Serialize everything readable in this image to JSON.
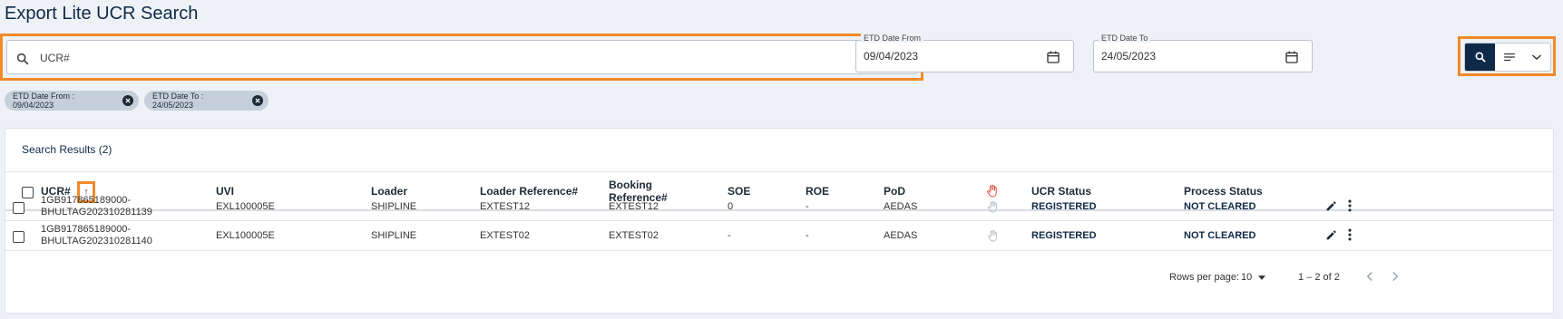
{
  "page": {
    "title": "Export Lite UCR Search"
  },
  "search": {
    "placeholder": "UCR#",
    "value": ""
  },
  "date_from": {
    "label": "ETD Date From",
    "value": "09/04/2023"
  },
  "date_to": {
    "label": "ETD Date To",
    "value": "24/05/2023"
  },
  "chips": [
    {
      "label": "ETD Date From : 09/04/2023"
    },
    {
      "label": "ETD Date To : 24/05/2023"
    }
  ],
  "results": {
    "title": "Search Results (2)",
    "columns": {
      "ucr": "UCR#",
      "uvi": "UVI",
      "loader": "Loader",
      "loader_ref": "Loader Reference#",
      "booking_ref_1": "Booking",
      "booking_ref_2": "Reference#",
      "soe": "SOE",
      "roe": "ROE",
      "pod": "PoD",
      "ucr_status": "UCR Status",
      "process_status": "Process Status"
    },
    "rows": [
      {
        "ucr_line1": "1GB917865189000-",
        "ucr_line2": "BHULTAG202310281139",
        "uvi": "EXL100005E",
        "loader": "SHIPLINE",
        "loader_ref": "EXTEST12",
        "booking_ref": "EXTEST12",
        "soe": "0",
        "roe": "-",
        "pod": "AEDAS",
        "ucr_status": "REGISTERED",
        "process_status": "NOT CLEARED"
      },
      {
        "ucr_line1": "1GB917865189000-",
        "ucr_line2": "BHULTAG202310281140",
        "uvi": "EXL100005E",
        "loader": "SHIPLINE",
        "loader_ref": "EXTEST02",
        "booking_ref": "EXTEST02",
        "soe": "-",
        "roe": "-",
        "pod": "AEDAS",
        "ucr_status": "REGISTERED",
        "process_status": "NOT CLEARED"
      }
    ]
  },
  "pagination": {
    "rows_per_page_label": "Rows per page:",
    "rows_per_page": "10",
    "range": "1 – 2 of 2"
  },
  "icons": {
    "search": "search-icon",
    "calendar": "calendar-icon",
    "filter": "filter-lines-icon",
    "chevron": "chevron-down-icon",
    "close": "close-circle-icon",
    "sort": "arrow-up-icon",
    "hand": "hand-icon",
    "edit": "pencil-icon",
    "more": "more-vertical-icon"
  },
  "colors": {
    "accent": "#0f2a47",
    "highlight": "#f08a2a",
    "hand_header": "#e04b3c"
  }
}
